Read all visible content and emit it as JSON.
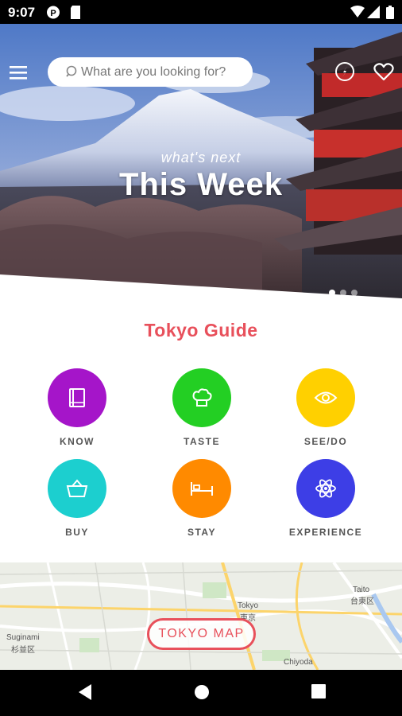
{
  "status_bar": {
    "time": "9:07"
  },
  "search": {
    "placeholder": "What are you looking for?"
  },
  "hero": {
    "kicker": "what's next",
    "headline": "This Week",
    "carousel_pages": 3,
    "carousel_active": 1
  },
  "guide": {
    "title": "Tokyo Guide",
    "categories": [
      {
        "label": "KNOW",
        "color": "#a515c9",
        "icon": "book-icon"
      },
      {
        "label": "TASTE",
        "color": "#23cf23",
        "icon": "chef-hat-icon"
      },
      {
        "label": "SEE/DO",
        "color": "#ffd000",
        "icon": "eye-icon"
      },
      {
        "label": "BUY",
        "color": "#1ccfcf",
        "icon": "basket-icon"
      },
      {
        "label": "STAY",
        "color": "#ff8a00",
        "icon": "bed-icon"
      },
      {
        "label": "EXPERIENCE",
        "color": "#3d3ee6",
        "icon": "atom-icon"
      }
    ]
  },
  "map": {
    "button_label": "TOKYO MAP",
    "place_labels": [
      "Suginami",
      "杉並区",
      "Tokyo",
      "東京",
      "Taito",
      "台東区",
      "Chiyoda"
    ]
  },
  "colors": {
    "accent": "#e8505b"
  }
}
